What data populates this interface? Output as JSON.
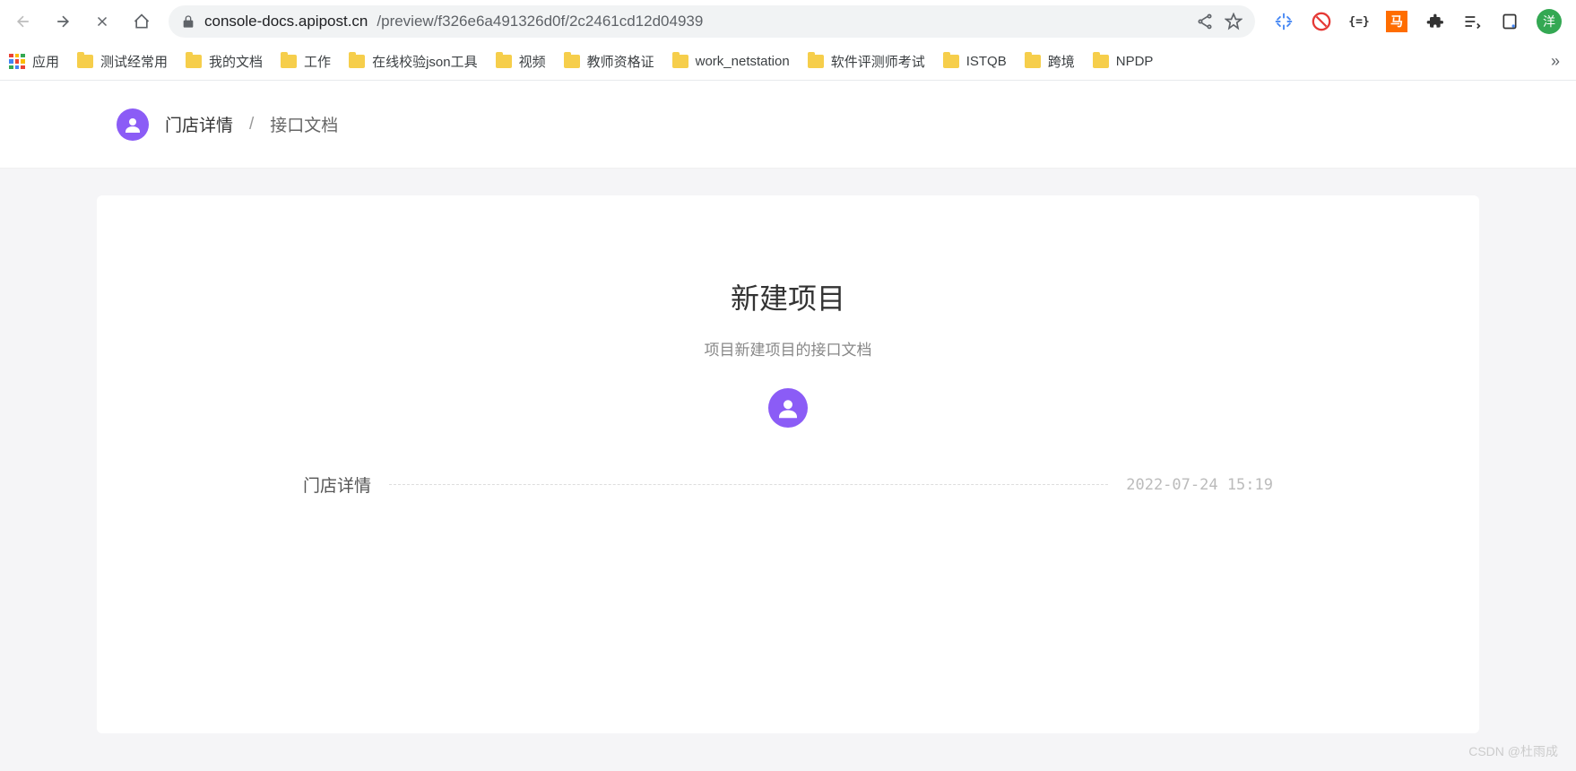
{
  "browser": {
    "url_host": "console-docs.apipost.cn",
    "url_path": "/preview/f326e6a491326d0f/2c2461cd12d04939",
    "profile_initial": "洋"
  },
  "bookmarks": {
    "apps_label": "应用",
    "items": [
      "测试经常用",
      "我的文档",
      "工作",
      "在线校验json工具",
      "视频",
      "教师资格证",
      "work_netstation",
      "软件评测师考试",
      "ISTQB",
      "跨境",
      "NPDP"
    ],
    "overflow": "»"
  },
  "header": {
    "crumb1": "门店详情",
    "sep": "/",
    "crumb2": "接口文档"
  },
  "content": {
    "title": "新建项目",
    "subtitle": "项目新建项目的接口文档",
    "section_label": "门店详情",
    "timestamp": "2022-07-24 15:19"
  },
  "watermark": "CSDN @杜雨成"
}
